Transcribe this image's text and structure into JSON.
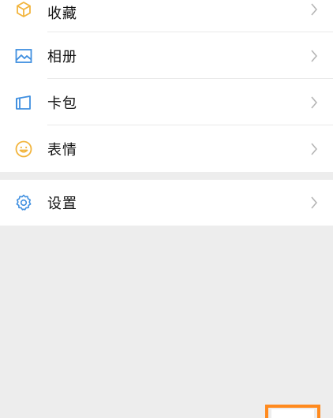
{
  "menu_group_1": [
    {
      "label": "收藏",
      "icon": "cube-icon"
    },
    {
      "label": "相册",
      "icon": "photo-icon"
    },
    {
      "label": "卡包",
      "icon": "card-wallet-icon"
    },
    {
      "label": "表情",
      "icon": "smiley-icon"
    }
  ],
  "menu_group_2": [
    {
      "label": "设置",
      "icon": "gear-icon"
    }
  ],
  "colors": {
    "favorites_icon": "#f2b43c",
    "blue_icon": "#3f8fe0",
    "smiley_icon": "#f2b43c",
    "chevron": "#b5b5b5",
    "background": "#ededed",
    "accent_orange": "#ff8a1e"
  }
}
